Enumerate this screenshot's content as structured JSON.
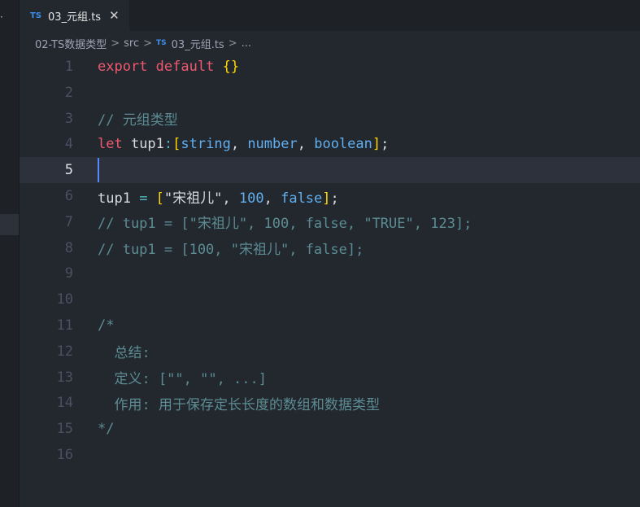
{
  "tab": {
    "badge": "TS",
    "title": "03_元组.ts",
    "close_glyph": "✕"
  },
  "breadcrumb": {
    "folder": "02-TS数据类型",
    "src": "src",
    "badge": "TS",
    "file": "03_元组.ts",
    "more": "...",
    "separator": ">"
  },
  "editor": {
    "current_line": 5,
    "lines": [
      {
        "n": "1",
        "tokens": [
          {
            "t": "export",
            "c": "kw"
          },
          {
            "t": " ",
            "c": "plain"
          },
          {
            "t": "default",
            "c": "kw"
          },
          {
            "t": " ",
            "c": "plain"
          },
          {
            "t": "{}",
            "c": "brace"
          }
        ]
      },
      {
        "n": "2",
        "tokens": []
      },
      {
        "n": "3",
        "tokens": [
          {
            "t": "// 元组类型",
            "c": "comment"
          }
        ]
      },
      {
        "n": "4",
        "tokens": [
          {
            "t": "let",
            "c": "kw"
          },
          {
            "t": " tup1",
            "c": "plain"
          },
          {
            "t": ":",
            "c": "op"
          },
          {
            "t": "[",
            "c": "brace"
          },
          {
            "t": "string",
            "c": "type"
          },
          {
            "t": ", ",
            "c": "plain"
          },
          {
            "t": "number",
            "c": "type"
          },
          {
            "t": ", ",
            "c": "plain"
          },
          {
            "t": "boolean",
            "c": "type"
          },
          {
            "t": "]",
            "c": "brace"
          },
          {
            "t": ";",
            "c": "plain"
          }
        ]
      },
      {
        "n": "5",
        "tokens": [],
        "cursor": true
      },
      {
        "n": "6",
        "tokens": [
          {
            "t": "tup1",
            "c": "plain"
          },
          {
            "t": " = ",
            "c": "op"
          },
          {
            "t": "[",
            "c": "brace"
          },
          {
            "t": "\"宋祖儿\"",
            "c": "plain"
          },
          {
            "t": ", ",
            "c": "plain"
          },
          {
            "t": "100",
            "c": "type"
          },
          {
            "t": ", ",
            "c": "plain"
          },
          {
            "t": "false",
            "c": "type"
          },
          {
            "t": "]",
            "c": "brace"
          },
          {
            "t": ";",
            "c": "plain"
          }
        ]
      },
      {
        "n": "7",
        "tokens": [
          {
            "t": "// tup1 = [\"宋祖儿\", 100, false, \"TRUE\", 123];",
            "c": "comment"
          }
        ]
      },
      {
        "n": "8",
        "tokens": [
          {
            "t": "// tup1 = [100, \"宋祖儿\", false];",
            "c": "comment"
          }
        ]
      },
      {
        "n": "9",
        "tokens": []
      },
      {
        "n": "10",
        "tokens": []
      },
      {
        "n": "11",
        "tokens": [
          {
            "t": "/*",
            "c": "comment"
          }
        ]
      },
      {
        "n": "12",
        "tokens": [
          {
            "t": "  总结:",
            "c": "comment"
          }
        ]
      },
      {
        "n": "13",
        "tokens": [
          {
            "t": "  定义: [\"\", \"\", ...]",
            "c": "comment"
          }
        ]
      },
      {
        "n": "14",
        "tokens": [
          {
            "t": "  作用: 用于保存定长长度的数组和数据类型",
            "c": "comment"
          }
        ]
      },
      {
        "n": "15",
        "tokens": [
          {
            "t": "*/",
            "c": "comment"
          }
        ]
      },
      {
        "n": "16",
        "tokens": []
      }
    ]
  },
  "colors": {
    "background": "#23272e",
    "keyword": "#ef596f",
    "type": "#61afef",
    "comment": "#5c8c93",
    "cursor": "#528bff"
  },
  "sidebar_glyph": "·"
}
